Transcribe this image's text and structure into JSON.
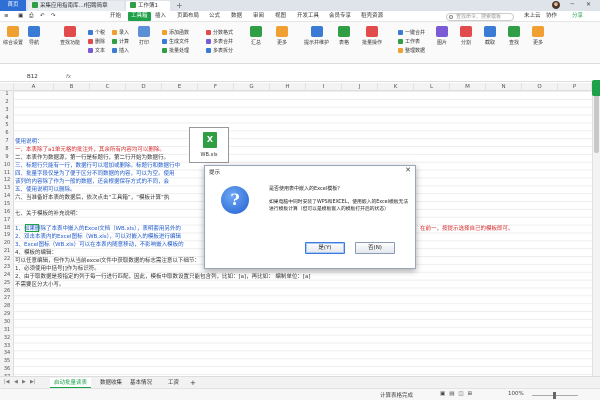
{
  "window": {
    "home_tab": "首页",
    "doc_tab_1": "采集应用指南库...f招聘简章",
    "doc_tab_2": "工作簿1",
    "new_tab": "+",
    "top_right_controls": "□ ─ ✕"
  },
  "menu": {
    "items": [
      "开始",
      "工具箱",
      "插入",
      "页面布局",
      "公式",
      "数据",
      "审阅",
      "视图",
      "开发工具",
      "会员专享",
      "稻壳资源"
    ],
    "active_index": 1,
    "search_placeholder": "查找命令、搜索模板",
    "share": "未上云",
    "collab": "协作",
    "share_btn": "分享"
  },
  "ribbon": {
    "big_buttons": [
      "综合设置",
      "导航",
      "查找功能",
      "删除",
      "文本",
      "生成文件",
      "汇总",
      "更多",
      "提示并维护",
      "表格",
      "批量操作",
      "图片",
      "分割",
      "截取",
      "查找",
      "更多"
    ],
    "small_items": [
      "个税",
      "录入",
      "计算",
      "插入",
      "打印",
      "添加函数",
      "分数格式",
      "批量处理",
      "多表合并",
      "多表拆分",
      "一键合并",
      "工作表",
      "整理数据"
    ]
  },
  "formula_bar": {
    "cell_ref": "B12",
    "fx": "fx"
  },
  "columns": [
    "A",
    "B",
    "C",
    "D",
    "E",
    "F",
    "G",
    "H",
    "I",
    "J",
    "K",
    "L",
    "M",
    "N",
    "O",
    "P"
  ],
  "rows": [
    "1",
    "2",
    "3",
    "4",
    "5",
    "6",
    "7",
    "8",
    "9",
    "10",
    "11",
    "12",
    "13",
    "14",
    "15",
    "16",
    "17",
    "18",
    "19",
    "20",
    "21",
    "22",
    "23",
    "24",
    "25",
    "26",
    "27",
    "28",
    "29",
    "30",
    "31",
    "32",
    "33",
    "34",
    "35",
    "36",
    "37"
  ],
  "sheet_lines": {
    "l13": "使用说明：",
    "l14": "一、本表除了a1单元格的批注外，其余所有内容均可以删除。",
    "l15": "二、本表作为数据源，第一行是标题行，第二行开始为数据行。",
    "l16": "三、标题行只能有一行，数据行可以增加或删除。标题行和数据行中",
    "l17": "四、批量字段仅是为了便于区分不同数据的内容，可以为空。使用",
    "l18": "    该列的内容除了作为一般的数据，还会根据保存方式的不同，会",
    "l19": "五、使用说明可以删除。",
    "l20": "六、当准备好本表的数据后，依次点击“工具箱”，“模板计算”执",
    "l22": "七、关于模板的补充说明：",
    "l23": "1、如果删除了本表中嵌入的Excel文档（WB.xls），表明套用另外的",
    "l24": "2、双击本表内的Excel图标（WB.xls），可以对嵌入的模板进行编辑",
    "l25": "3、Excel图标（WB.xls）可以在本表内随意移动，不影响嵌入模板的",
    "l26": "4、模板的编辑：",
    "l27": "    可以任意编辑，但作为从当前excel文件中获取数据的标志需注意以下细节：",
    "l28": "    1、必须使用中括号[]作为标识符。",
    "l29": "    2、由于取数据是按指定的列于每一行进行匹配，因此，模板中取数设置只能包含列，比如：[a]，再比如：   编制单位：[a]",
    "l30": "       不需要区分大小写。",
    "l20_tail": "在前一，按提示选择自己的模板即可。"
  },
  "embedded_file": {
    "label": "WB.xls",
    "icon": "excel-file-icon"
  },
  "dialog": {
    "title": "提示",
    "close": "✕",
    "question": "是否使用表中嵌入的Excel模板？",
    "detail": "如果电脑中同时安装了WPS和EXCEL，使用嵌入的Excel模板无法进行模板计算（但可以是模板嵌入的模板打开后的状态）",
    "yes": "是(Y)",
    "no": "否(N)"
  },
  "sheets": {
    "tabs": [
      "启动批量读表",
      "数据收集",
      "基本情况",
      "工资"
    ],
    "active_index": 0,
    "add": "+"
  },
  "status": {
    "left": "计算表格完成",
    "zoom": "100%"
  },
  "colors": {
    "accent": "#1fa14a",
    "link_blue": "#1d58c9",
    "note_red": "#d42a2a"
  }
}
